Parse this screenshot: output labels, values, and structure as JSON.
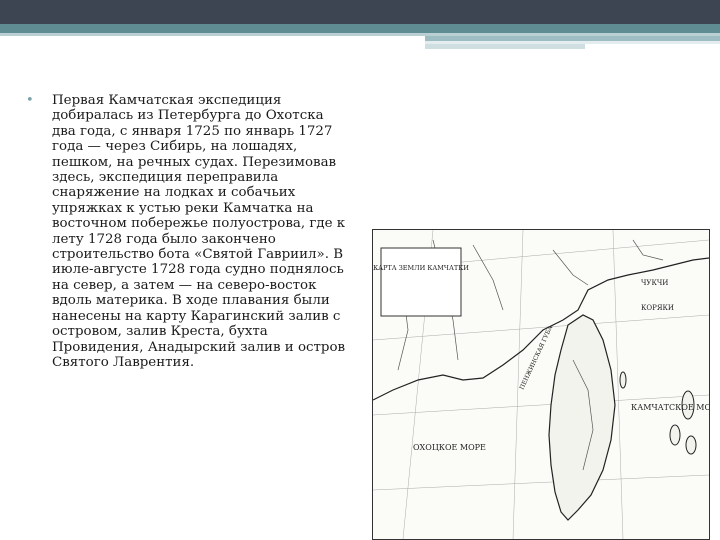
{
  "slide": {
    "paragraph": "Первая Камчатская экспедиция добиралась из Петербурга до Охотска два года, с января 1725 по январь 1727 года — через Сибирь, на лошадях, пешком, на речных судах. Перезимовав здесь, экспедиция переправила снаряжение на лодках и собачьих упряжках к устью реки Камчатка на восточном побережье полуострова, где к лету 1728 года было закончено строительство бота «Святой Гавриил». В июле-августе 1728 года судно поднялось на север, а затем — на северо-восток вдоль материка. В ходе плавания были нанесены на карту Карагинский залив с островом, залив Креста, бухта Провидения, Анадырский залив и остров Святого Лаврентия.",
    "bullet": "•"
  },
  "map": {
    "cartouche_title": "КАРТА ЗЕМЛИ КАМЧАТКИ",
    "label_sea_okhotsk": "ОХОЦКОЕ МОРЕ",
    "label_kamchatka_sea": "КАМЧАТСКОЕ МОРЕ",
    "label_peninsula": "ПЕНЖИНСКАЯ ГУБА",
    "label_chukchi": "ЧУКЧИ",
    "label_koryaki": "КОРЯКИ"
  },
  "colors": {
    "top_bar": "#3d4553",
    "accent": "#5f8c92",
    "bullet": "#7aa4aa"
  }
}
